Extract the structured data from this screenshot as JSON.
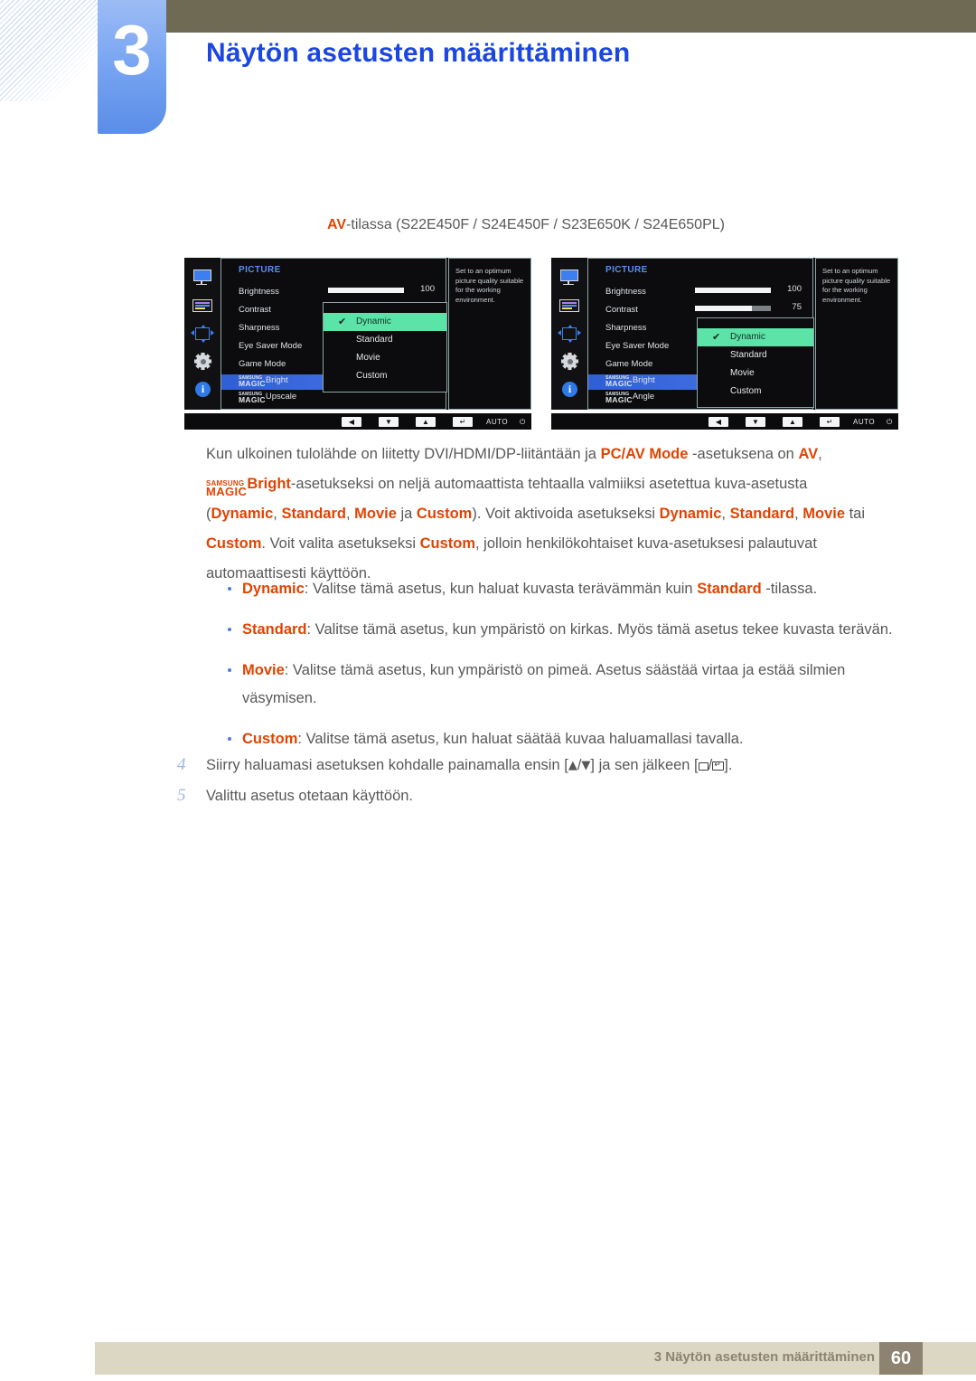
{
  "header": {
    "chapter_number": "3",
    "title": "Näytön asetusten määrittäminen",
    "accent_color": "#1b46e0",
    "bar_color": "#6e6a54"
  },
  "subtitle": {
    "highlight": "AV",
    "rest": "-tilassa (S22E450F / S24E450F / S23E650K / S24E650PL)"
  },
  "osd": {
    "icons": [
      "monitor-icon",
      "osd-list-icon",
      "arrows-icon",
      "gear-icon",
      "info-icon"
    ],
    "info_text": "Set to an optimum picture quality suitable for the working environment.",
    "submenu_items": [
      "Dynamic",
      "Standard",
      "Movie",
      "Custom"
    ],
    "submenu_selected": "Dynamic",
    "buttons": [
      "left",
      "down",
      "up",
      "enter",
      "AUTO",
      "power"
    ],
    "auto_label": "AUTO",
    "left": {
      "title": "PICTURE",
      "rows": [
        "Brightness",
        "Contrast",
        "Sharpness",
        "Eye Saver Mode",
        "Game Mode"
      ],
      "magic_rows": [
        {
          "samsung": "SAMSUNG",
          "magic": "MAGIC",
          "suffix": "Bright",
          "selected": true
        },
        {
          "samsung": "SAMSUNG",
          "magic": "MAGIC",
          "suffix": "Upscale",
          "selected": false
        }
      ],
      "brightness_value": "100",
      "brightness_pct": 100
    },
    "right": {
      "title": "PICTURE",
      "rows": [
        "Brightness",
        "Contrast",
        "Sharpness",
        "Eye Saver Mode",
        "Game Mode"
      ],
      "magic_rows": [
        {
          "samsung": "SAMSUNG",
          "magic": "MAGIC",
          "suffix": "Bright",
          "selected": true
        },
        {
          "samsung": "SAMSUNG",
          "magic": "MAGIC",
          "suffix": "Angle",
          "selected": false
        }
      ],
      "brightness_value": "100",
      "brightness_pct": 100,
      "contrast_value": "75",
      "contrast_pct": 75
    }
  },
  "body": {
    "p1_a": "Kun ulkoinen tulolähde on liitetty DVI/HDMI/DP-liitäntään ja ",
    "p1_b": "PC/AV Mode",
    "p1_c": " -asetuksena on ",
    "p1_d": "AV",
    "p1_e": ",",
    "magic_samsung": "SAMSUNG",
    "magic_magic": "MAGIC",
    "p2_bright": "Bright",
    "p2_a": "-asetukseksi on neljä automaattista tehtaalla valmiiksi asetettua kuva-asetusta",
    "p3_open": "(",
    "p3_dynamic": "Dynamic",
    "p3_c1": ", ",
    "p3_standard": "Standard",
    "p3_c2": ", ",
    "p3_movie": "Movie",
    "p3_ja": " ja ",
    "p3_custom": "Custom",
    "p3_close": "). Voit aktivoida asetukseksi ",
    "p3_dynamic2": "Dynamic",
    "p3_c3": ", ",
    "p3_standard2": "Standard",
    "p3_c4": ", ",
    "p3_movie2": "Movie",
    "p3_tai": " tai",
    "p4_custom": "Custom",
    "p4_a": ". Voit valita asetukseksi ",
    "p4_custom2": "Custom",
    "p4_b": ", jolloin henkilökohtaiset kuva-asetuksesi palautuvat",
    "p5": "automaattisesti käyttöön."
  },
  "bullets": [
    {
      "term": "Dynamic",
      "text_a": ": Valitse tämä asetus, kun haluat kuvasta terävämmän kuin ",
      "term2": "Standard",
      "text_b": " -tilassa."
    },
    {
      "term": "Standard",
      "text_a": ": Valitse tämä asetus, kun ympäristö on kirkas. Myös tämä asetus tekee kuvasta terävän.",
      "term2": "",
      "text_b": ""
    },
    {
      "term": "Movie",
      "text_a": ": Valitse tämä asetus, kun ympäristö on pimeä. Asetus säästää virtaa ja estää silmien väsymisen.",
      "term2": "",
      "text_b": ""
    },
    {
      "term": "Custom",
      "text_a": ": Valitse tämä asetus, kun haluat säätää kuvaa haluamallasi tavalla.",
      "term2": "",
      "text_b": ""
    }
  ],
  "steps": [
    {
      "number": "4",
      "text_a": "Siirry haluamasi asetuksen kohdalle painamalla ensin [",
      "glyph_a": "▲",
      "sep_a": "/",
      "glyph_b": "▼",
      "text_b": "] ja sen jälkeen [",
      "sep_b": "/",
      "text_c": "]."
    },
    {
      "number": "5",
      "text_a": "Valittu asetus otetaan käyttöön.",
      "glyph_a": "",
      "sep_a": "",
      "glyph_b": "",
      "text_b": "",
      "sep_b": "",
      "text_c": ""
    }
  ],
  "footer": {
    "text": "3 Näytön asetusten määrittäminen",
    "page": "60",
    "bar_color": "#dbd7c3",
    "page_color": "#8d8370"
  }
}
